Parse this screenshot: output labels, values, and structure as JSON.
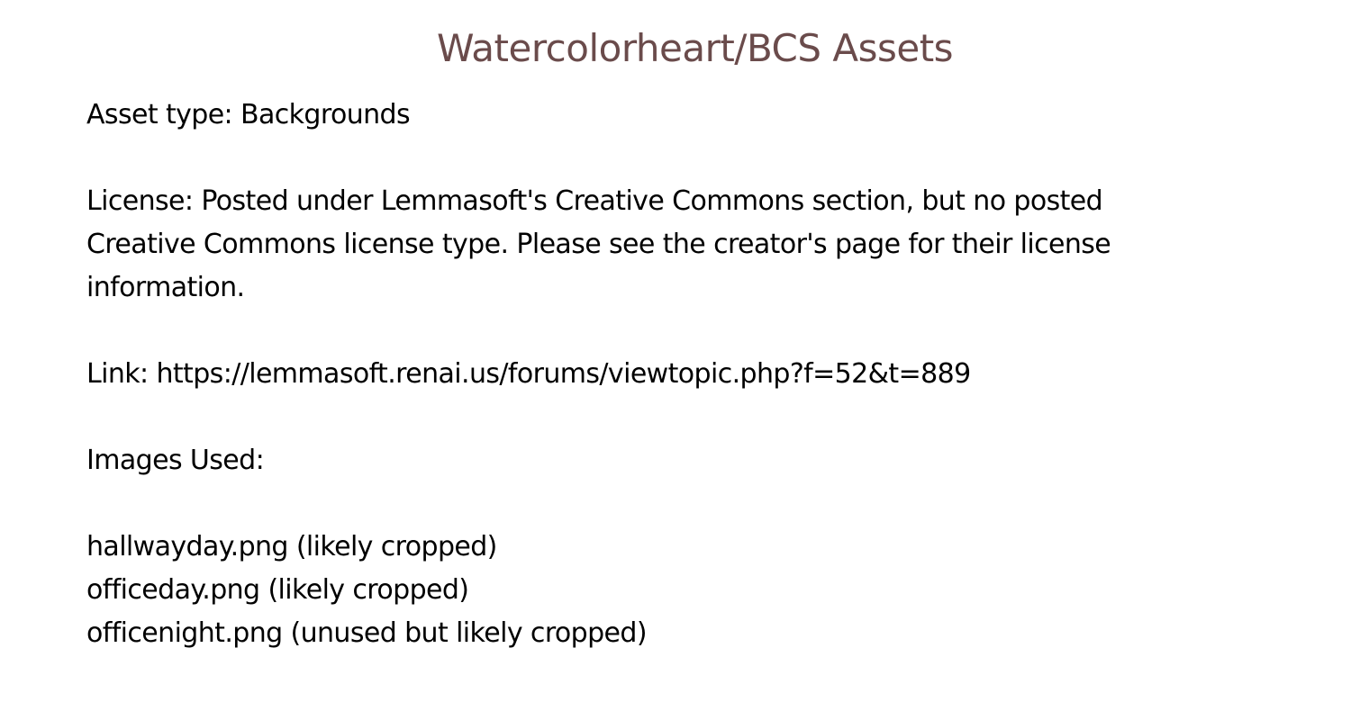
{
  "colors": {
    "title": "#6a4b4b",
    "text": "#000000",
    "background": "#ffffff"
  },
  "title": "Watercolorheart/BCS Assets",
  "asset_type": "Asset type: Backgrounds",
  "license_lines": [
    "License: Posted under Lemmasoft's Creative Commons section, but no posted",
    "Creative Commons license type. Please see the creator's page for their license",
    "information."
  ],
  "link": "Link: https://lemmasoft.renai.us/forums/viewtopic.php?f=52&t=889",
  "images_heading": "Images Used:",
  "images": [
    "hallwayday.png (likely cropped)",
    "officeday.png (likely cropped)",
    "officenight.png (unused but likely cropped)"
  ]
}
